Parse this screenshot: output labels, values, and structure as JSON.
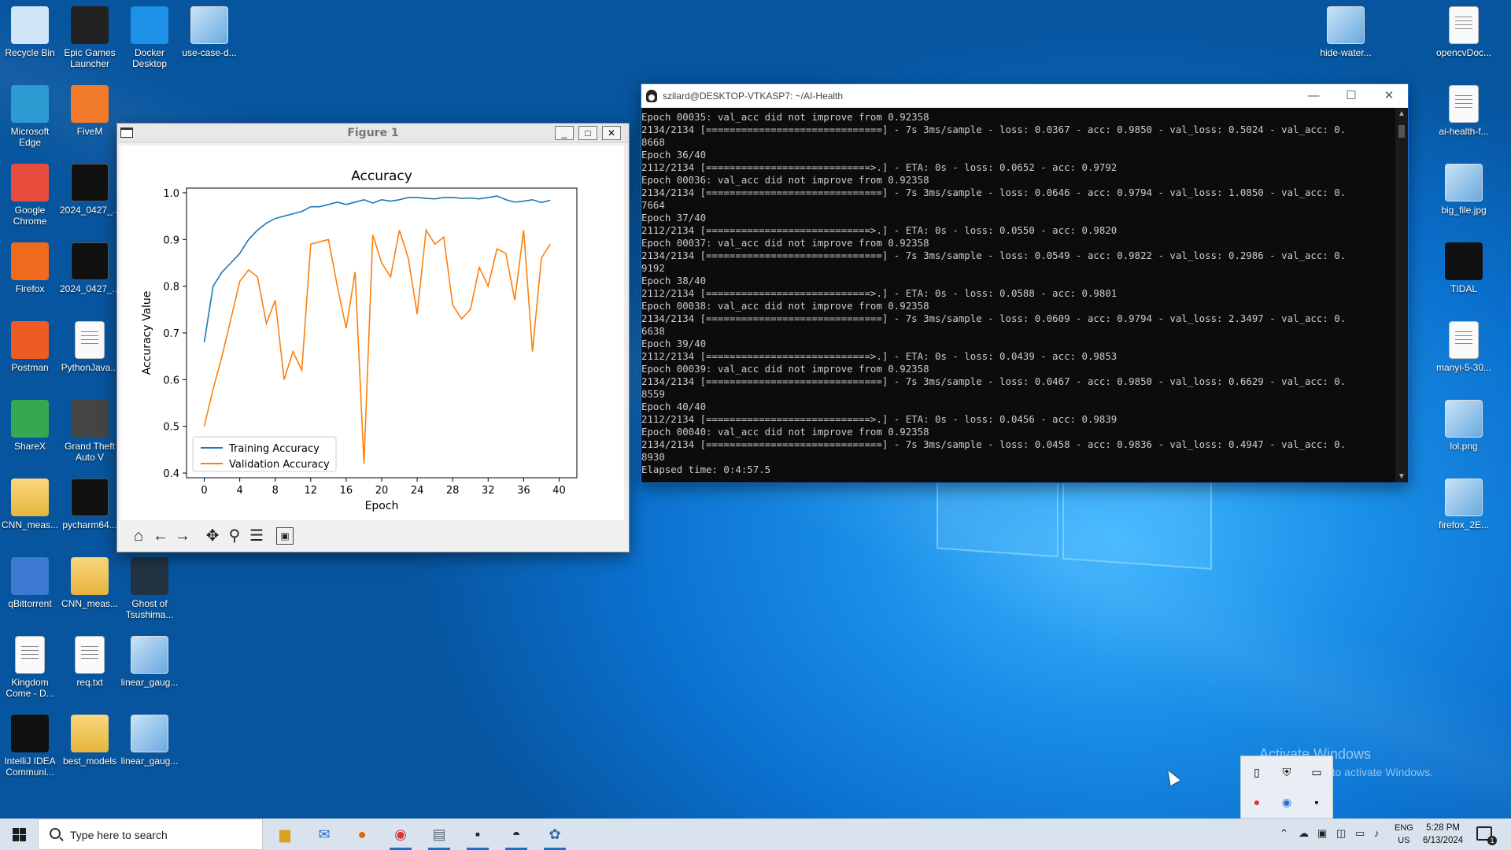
{
  "desktop": {
    "icons_left": [
      {
        "label": "Recycle Bin",
        "icon": "recycle-bin-icon"
      },
      {
        "label": "Epic Games Launcher",
        "icon": "epic-games-icon"
      },
      {
        "label": "Docker Desktop",
        "icon": "docker-icon"
      },
      {
        "label": "use-case-d...",
        "icon": "image-file-icon"
      },
      {
        "label": "Microsoft Edge",
        "icon": "edge-icon"
      },
      {
        "label": "FiveM",
        "icon": "fivem-icon"
      },
      {
        "label": "Google Chrome",
        "icon": "chrome-icon"
      },
      {
        "label": "2024_0427_...",
        "icon": "video-thumbnail-icon"
      },
      {
        "label": "Firefox",
        "icon": "firefox-icon"
      },
      {
        "label": "2024_0427_...",
        "icon": "video-thumbnail-icon"
      },
      {
        "label": "Postman",
        "icon": "postman-icon"
      },
      {
        "label": "PythonJava...",
        "icon": "text-file-icon"
      },
      {
        "label": "ShareX",
        "icon": "sharex-icon"
      },
      {
        "label": "Grand Theft Auto V",
        "icon": "gta-icon"
      },
      {
        "label": "CNN_meas...",
        "icon": "zip-folder-icon"
      },
      {
        "label": "pycharm64...",
        "icon": "pycharm-icon"
      },
      {
        "label": "qBittorrent",
        "icon": "qbittorrent-icon"
      },
      {
        "label": "CNN_meas...",
        "icon": "folder-icon"
      },
      {
        "label": "Ghost of Tsushima...",
        "icon": "ghost-icon"
      },
      {
        "label": "Kingdom Come - D...",
        "icon": "text-file-icon"
      },
      {
        "label": "req.txt",
        "icon": "text-file-icon"
      },
      {
        "label": "linear_gaug...",
        "icon": "image-file-icon"
      },
      {
        "label": "IntelliJ IDEA Communi...",
        "icon": "intellij-icon"
      },
      {
        "label": "best_models",
        "icon": "folder-icon"
      },
      {
        "label": "linear_gaug...",
        "icon": "image-file-icon"
      }
    ],
    "icons_right": [
      {
        "label": "hide-water...",
        "icon": "settings-file-icon"
      },
      {
        "label": "opencvDoc...",
        "icon": "text-file-icon"
      },
      {
        "label": "ai-health-f...",
        "icon": "text-file-icon"
      },
      {
        "label": "big_file.jpg",
        "icon": "image-file-icon"
      },
      {
        "label": "TIDAL",
        "icon": "tidal-icon"
      },
      {
        "label": "manyi-5-30...",
        "icon": "text-file-icon"
      },
      {
        "label": "lol.png",
        "icon": "image-file-icon"
      },
      {
        "label": "firefox_2E...",
        "icon": "image-file-icon"
      }
    ]
  },
  "figure": {
    "title": "Figure 1",
    "controls": {
      "minimize": "_",
      "maximize": "□",
      "close": "✕"
    },
    "toolbar": [
      "home-icon",
      "back-icon",
      "forward-icon",
      "pan-icon",
      "zoom-icon",
      "configure-icon",
      "save-icon"
    ]
  },
  "chart_data": {
    "type": "line",
    "title": "Accuracy",
    "xlabel": "Epoch",
    "ylabel": "Accuracy Value",
    "xlim": [
      -2,
      42
    ],
    "ylim": [
      0.39,
      1.01
    ],
    "xticks": [
      0,
      4,
      8,
      12,
      16,
      20,
      24,
      28,
      32,
      36,
      40
    ],
    "yticks": [
      0.4,
      0.5,
      0.6,
      0.7,
      0.8,
      0.9,
      1.0
    ],
    "legend": "lower-left",
    "grid": false,
    "series": [
      {
        "name": "Training Accuracy",
        "color": "#1f77b4",
        "x": [
          0,
          1,
          2,
          3,
          4,
          5,
          6,
          7,
          8,
          9,
          10,
          11,
          12,
          13,
          14,
          15,
          16,
          17,
          18,
          19,
          20,
          21,
          22,
          23,
          24,
          25,
          26,
          27,
          28,
          29,
          30,
          31,
          32,
          33,
          34,
          35,
          36,
          37,
          38,
          39
        ],
        "y": [
          0.68,
          0.8,
          0.83,
          0.85,
          0.87,
          0.9,
          0.92,
          0.935,
          0.945,
          0.95,
          0.955,
          0.96,
          0.97,
          0.97,
          0.975,
          0.98,
          0.975,
          0.98,
          0.985,
          0.978,
          0.985,
          0.982,
          0.985,
          0.99,
          0.99,
          0.988,
          0.987,
          0.99,
          0.99,
          0.988,
          0.989,
          0.987,
          0.99,
          0.993,
          0.985,
          0.98,
          0.982,
          0.985,
          0.979,
          0.984
        ]
      },
      {
        "name": "Validation Accuracy",
        "color": "#ff7f0e",
        "x": [
          0,
          1,
          2,
          3,
          4,
          5,
          6,
          7,
          8,
          9,
          10,
          11,
          12,
          13,
          14,
          15,
          16,
          17,
          18,
          19,
          20,
          21,
          22,
          23,
          24,
          25,
          26,
          27,
          28,
          29,
          30,
          31,
          32,
          33,
          34,
          35,
          36,
          37,
          38,
          39
        ],
        "y": [
          0.5,
          0.58,
          0.65,
          0.73,
          0.81,
          0.835,
          0.82,
          0.72,
          0.77,
          0.6,
          0.66,
          0.62,
          0.89,
          0.895,
          0.9,
          0.8,
          0.71,
          0.83,
          0.42,
          0.91,
          0.85,
          0.82,
          0.92,
          0.86,
          0.74,
          0.92,
          0.89,
          0.905,
          0.76,
          0.73,
          0.75,
          0.84,
          0.8,
          0.88,
          0.87,
          0.77,
          0.92,
          0.66,
          0.86,
          0.89
        ]
      }
    ]
  },
  "terminal": {
    "title": "szilard@DESKTOP-VTKASP7: ~/AI-Health",
    "controls": {
      "minimize": "—",
      "maximize": "☐",
      "close": "✕"
    },
    "lines": [
      "Epoch 00035: val_acc did not improve from 0.92358",
      "2134/2134 [==============================] - 7s 3ms/sample - loss: 0.0367 - acc: 0.9850 - val_loss: 0.5024 - val_acc: 0.",
      "8668",
      "Epoch 36/40",
      "2112/2134 [============================>.] - ETA: 0s - loss: 0.0652 - acc: 0.9792",
      "Epoch 00036: val_acc did not improve from 0.92358",
      "2134/2134 [==============================] - 7s 3ms/sample - loss: 0.0646 - acc: 0.9794 - val_loss: 1.0850 - val_acc: 0.",
      "7664",
      "Epoch 37/40",
      "2112/2134 [============================>.] - ETA: 0s - loss: 0.0550 - acc: 0.9820",
      "Epoch 00037: val_acc did not improve from 0.92358",
      "2134/2134 [==============================] - 7s 3ms/sample - loss: 0.0549 - acc: 0.9822 - val_loss: 0.2986 - val_acc: 0.",
      "9192",
      "Epoch 38/40",
      "2112/2134 [============================>.] - ETA: 0s - loss: 0.0588 - acc: 0.9801",
      "Epoch 00038: val_acc did not improve from 0.92358",
      "2134/2134 [==============================] - 7s 3ms/sample - loss: 0.0609 - acc: 0.9794 - val_loss: 2.3497 - val_acc: 0.",
      "6638",
      "Epoch 39/40",
      "2112/2134 [============================>.] - ETA: 0s - loss: 0.0439 - acc: 0.9853",
      "Epoch 00039: val_acc did not improve from 0.92358",
      "2134/2134 [==============================] - 7s 3ms/sample - loss: 0.0467 - acc: 0.9850 - val_loss: 0.6629 - val_acc: 0.",
      "8559",
      "Epoch 40/40",
      "2112/2134 [============================>.] - ETA: 0s - loss: 0.0456 - acc: 0.9839",
      "Epoch 00040: val_acc did not improve from 0.92358",
      "2134/2134 [==============================] - 7s 3ms/sample - loss: 0.0458 - acc: 0.9836 - val_loss: 0.4947 - val_acc: 0.",
      "8930",
      "Elapsed time: 0:4:57.5"
    ]
  },
  "watermark": {
    "line1": "Activate Windows",
    "line2": "Go to Settings to activate Windows."
  },
  "taskbar": {
    "search_placeholder": "Type here to search",
    "apps": [
      "file-explorer-icon",
      "mail-icon",
      "firefox-icon",
      "chrome-icon",
      "photos-icon",
      "figure-app-icon",
      "linux-terminal-icon",
      "python-icon"
    ],
    "lang_line1": "ENG",
    "lang_line2": "US",
    "time": "5:28 PM",
    "date": "6/13/2024"
  }
}
